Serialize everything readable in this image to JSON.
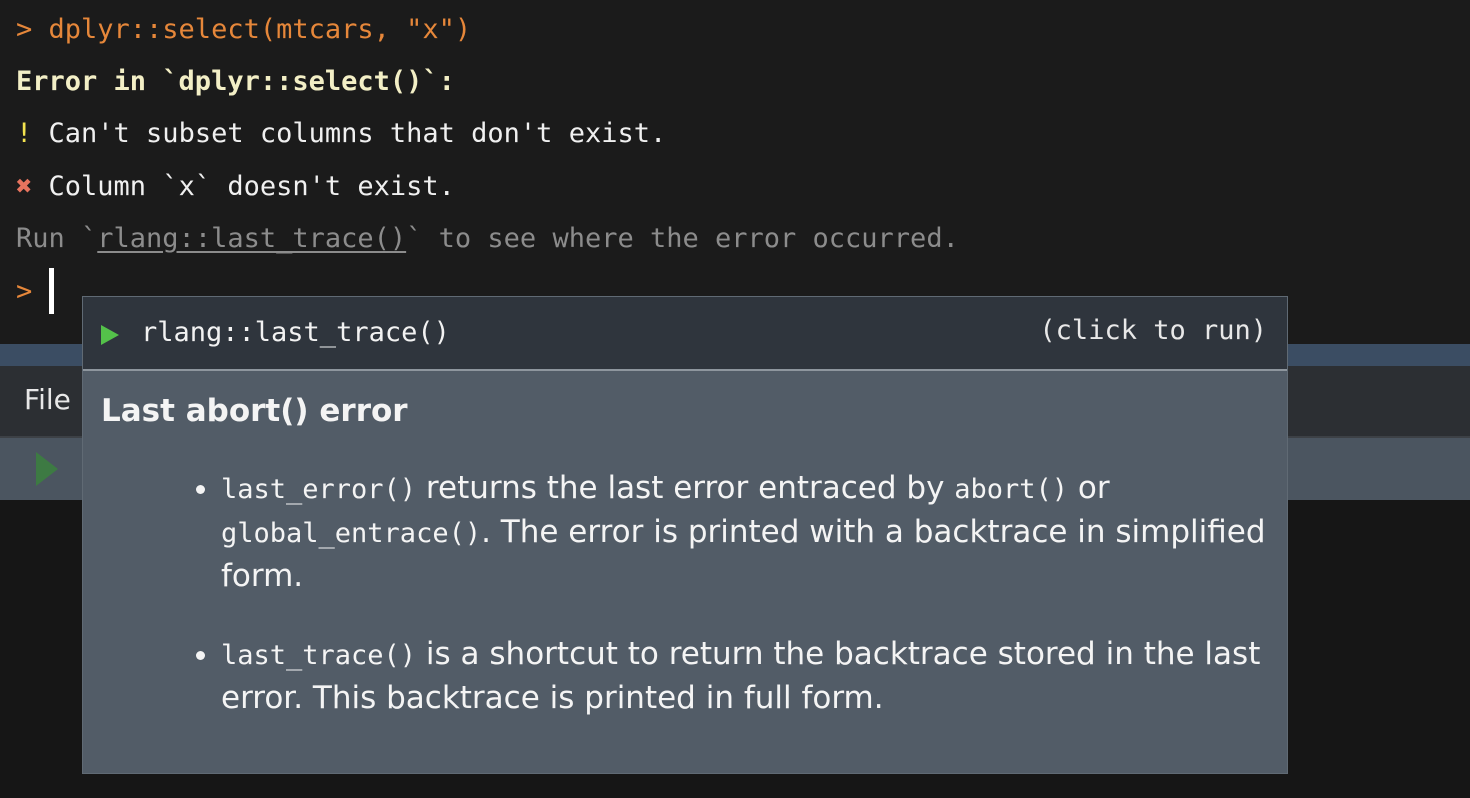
{
  "console": {
    "command_line": "> dplyr::select(mtcars, \"x\")",
    "error_header": "Error in `dplyr::select()`:",
    "bullet_bang": "!",
    "bullet_bang_text": " Can't subset columns that don't exist.",
    "bullet_cross": "✖",
    "bullet_cross_text": " Column `x` doesn't exist.",
    "hint_prefix": "Run `",
    "hint_link": "rlang::last_trace()",
    "hint_suffix": "` to see where the error occurred.",
    "prompt": ">"
  },
  "pane": {
    "file_tab_label": "File"
  },
  "popup": {
    "command": "rlang::last_trace()",
    "click_hint": "(click to run)",
    "title": "Last abort() error",
    "item1": {
      "code1": "last_error()",
      "text1": " returns the last error entraced by ",
      "code2": "abort()",
      "text2": " or ",
      "code3": "global_entrace()",
      "text3": ". The error is printed with a backtrace in simplified form."
    },
    "item2": {
      "code1": "last_trace()",
      "text1": " is a shortcut to return the backtrace stored in the last error. This backtrace is printed in full form."
    }
  }
}
